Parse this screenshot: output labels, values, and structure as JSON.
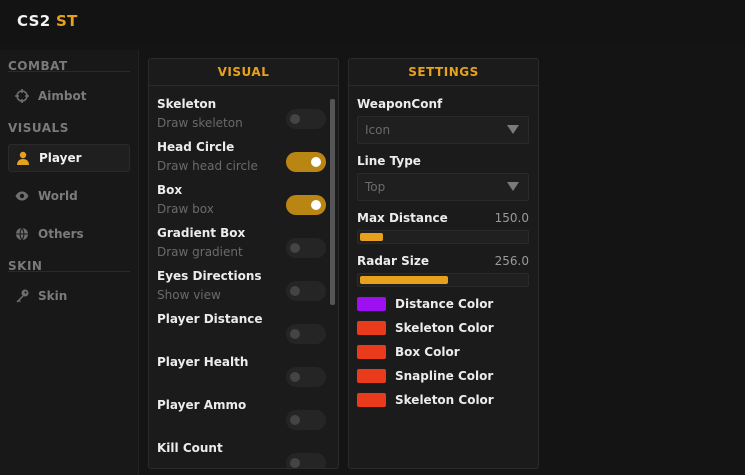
{
  "app": {
    "title_main": "CS2",
    "title_accent": "ST"
  },
  "sidebar": {
    "sections": [
      {
        "title": "COMBAT",
        "items": [
          {
            "label": "Aimbot",
            "icon": "crosshair-icon",
            "active": false
          }
        ]
      },
      {
        "title": "VISUALS",
        "items": [
          {
            "label": "Player",
            "icon": "person-icon",
            "active": true
          },
          {
            "label": "World",
            "icon": "eye-icon",
            "active": false
          },
          {
            "label": "Others",
            "icon": "globe-icon",
            "active": false
          }
        ]
      },
      {
        "title": "SKIN",
        "items": [
          {
            "label": "Skin",
            "icon": "key-icon",
            "active": false
          }
        ]
      }
    ]
  },
  "visual": {
    "header": "VISUAL",
    "options": [
      {
        "title": "Skeleton",
        "desc": "Draw skeleton",
        "on": false
      },
      {
        "title": "Head Circle",
        "desc": "Draw head circle",
        "on": true
      },
      {
        "title": "Box",
        "desc": "Draw box",
        "on": true
      },
      {
        "title": "Gradient Box",
        "desc": "Draw gradient",
        "on": false
      },
      {
        "title": "Eyes Directions",
        "desc": "Show view",
        "on": false
      },
      {
        "title": "Player Distance",
        "desc": "",
        "on": false
      },
      {
        "title": "Player Health",
        "desc": "",
        "on": false
      },
      {
        "title": "Player Ammo",
        "desc": "",
        "on": false
      },
      {
        "title": "Kill Count",
        "desc": "",
        "on": false
      }
    ]
  },
  "settings": {
    "header": "SETTINGS",
    "weapon_conf": {
      "label": "WeaponConf",
      "value": "Icon"
    },
    "line_type": {
      "label": "Line Type",
      "value": "Top"
    },
    "max_distance": {
      "label": "Max Distance",
      "value": "150.0",
      "fraction": 0.14
    },
    "radar_size": {
      "label": "Radar Size",
      "value": "256.0",
      "fraction": 0.53
    },
    "colors": [
      {
        "label": "Distance Color",
        "color": "#9b0ff0"
      },
      {
        "label": "Skeleton Color",
        "color": "#ea3a1c"
      },
      {
        "label": "Box Color",
        "color": "#ea3a1c"
      },
      {
        "label": "Snapline Color",
        "color": "#ea3a1c"
      },
      {
        "label": "Skeleton Color",
        "color": "#ea3a1c"
      }
    ]
  },
  "theme": {
    "accent": "#e8a11c"
  }
}
